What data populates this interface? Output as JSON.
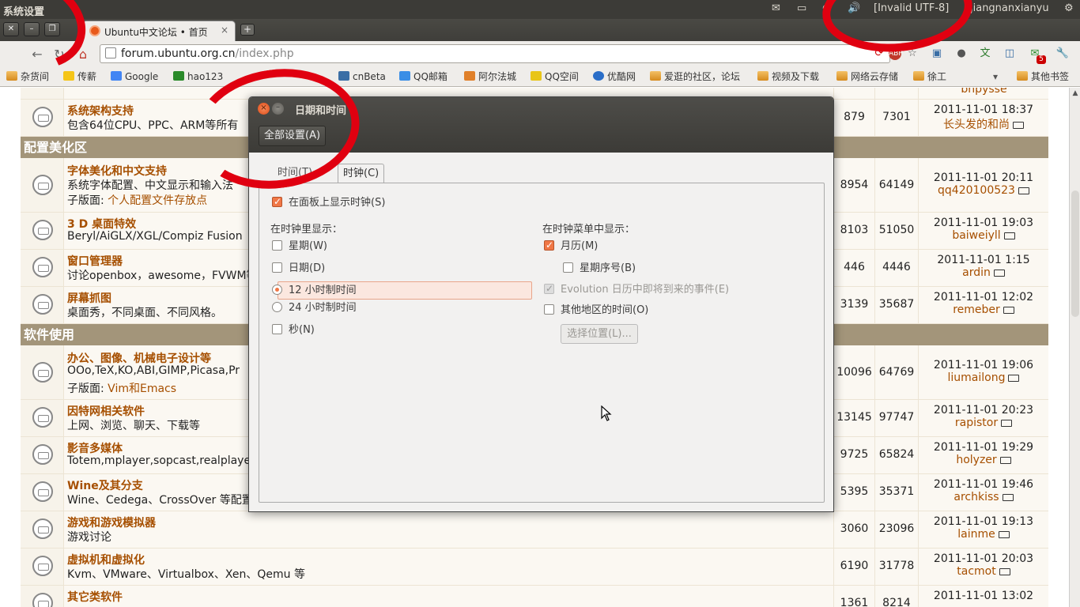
{
  "panel": {
    "window_title": "系统设置",
    "keyboard_layout": "[Invalid UTF-8]",
    "user": "jiangnanxianyu"
  },
  "browser": {
    "tab_title": "Ubuntu中文论坛 • 首页",
    "tab_close": "×",
    "new_tab": "+",
    "url_host": "forum.ubuntu.org.cn",
    "url_path": "/index.php",
    "ext_badge": "5",
    "bookmarks": [
      {
        "label": "杂货间"
      },
      {
        "label": "传薪"
      },
      {
        "label": "Google"
      },
      {
        "label": "hao123"
      },
      {
        "label": "cnBeta"
      },
      {
        "label": "QQ邮箱"
      },
      {
        "label": "阿尔法城"
      },
      {
        "label": "QQ空间"
      },
      {
        "label": "优酷网"
      },
      {
        "label": "爱逛的社区，论坛"
      },
      {
        "label": "视频及下载"
      },
      {
        "label": "网络云存储"
      },
      {
        "label": "徐工"
      },
      {
        "label": "其他书签"
      }
    ]
  },
  "forum": {
    "rows": [
      {
        "name": "",
        "desc": "...",
        "n1": "",
        "n2": "",
        "date": "",
        "user": "bnpysse"
      },
      {
        "name": "系统架构支持",
        "desc": "包含64位CPU、PPC、ARM等所有",
        "n1": "879",
        "n2": "7301",
        "date": "2011-11-01 18:37",
        "user": "长头发的和尚"
      },
      {
        "name": "字体美化和中文支持",
        "desc": "系统字体配置、中文显示和输入法",
        "sub_label": "子版面:",
        "sub_link": "个人配置文件存放点",
        "n1": "8954",
        "n2": "64149",
        "date": "2011-11-01 20:11",
        "user": "qq420100523"
      },
      {
        "name": "3 D 桌面特效",
        "desc": "Beryl/AiGLX/XGL/Compiz Fusion",
        "n1": "8103",
        "n2": "51050",
        "date": "2011-11-01 19:03",
        "user": "baiweiyll"
      },
      {
        "name": "窗口管理器",
        "desc": "讨论openbox，awesome，FVWM等",
        "n1": "446",
        "n2": "4446",
        "date": "2011-11-01 1:15",
        "user": "ardin"
      },
      {
        "name": "屏幕抓图",
        "desc": "桌面秀，不同桌面、不同风格。",
        "n1": "3139",
        "n2": "35687",
        "date": "2011-11-01 12:02",
        "user": "remeber"
      },
      {
        "name": "办公、图像、机械电子设计等",
        "desc": "OOo,TeX,KO,ABI,GIMP,Picasa,Pr",
        "sub_label": "子版面:",
        "sub_link": "Vim和Emacs",
        "n1": "10096",
        "n2": "64769",
        "date": "2011-11-01 19:06",
        "user": "liumailong"
      },
      {
        "name": "因特网相关软件",
        "desc": "上网、浏览、聊天、下载等",
        "n1": "13145",
        "n2": "97747",
        "date": "2011-11-01 20:23",
        "user": "rapistor"
      },
      {
        "name": "影音多媒体",
        "desc": "Totem,mplayer,sopcast,realplayer,k",
        "n1": "9725",
        "n2": "65824",
        "date": "2011-11-01 19:29",
        "user": "holyzer"
      },
      {
        "name": "Wine及其分支",
        "desc": "Wine、Cedega、CrossOver 等配置",
        "n1": "5395",
        "n2": "35371",
        "date": "2011-11-01 19:46",
        "user": "archkiss"
      },
      {
        "name": "游戏和游戏模拟器",
        "desc": "游戏讨论",
        "n1": "3060",
        "n2": "23096",
        "date": "2011-11-01 19:13",
        "user": "lainme"
      },
      {
        "name": "虚拟机和虚拟化",
        "desc": "Kvm、VMware、Virtualbox、Xen、Qemu 等",
        "n1": "6190",
        "n2": "31778",
        "date": "2011-11-01 20:03",
        "user": "tacmot"
      },
      {
        "name": "其它类软件",
        "desc": "",
        "n1": "1361",
        "n2": "8214",
        "date": "2011-11-01 13:02",
        "user": ""
      }
    ],
    "categories": [
      "配置美化区",
      "软件使用"
    ]
  },
  "dialog": {
    "title": "日期和时间",
    "all_settings": "全部设置(A)",
    "tab_time": "时间(T)",
    "tab_clock": "时钟(C)",
    "show_clock": "在面板上显示时钟(S)",
    "in_clock_header": "在时钟里显示：",
    "weekday": "星期(W)",
    "date": "日期(D)",
    "h12": "12 小时制时间",
    "h24": "24 小时制时间",
    "seconds": "秒(N)",
    "in_menu_header": "在时钟菜单中显示：",
    "calendar": "月历(M)",
    "week_numbers": "星期序号(B)",
    "evolution": "Evolution 日历中即将到来的事件(E)",
    "other_locations": "其他地区的时间(O)",
    "choose_locations": "选择位置(L)..."
  },
  "colors": {
    "accent": "#f07746",
    "forum_link": "#a64f00",
    "category_bar": "#a3957a",
    "annotation": "#e00010"
  }
}
